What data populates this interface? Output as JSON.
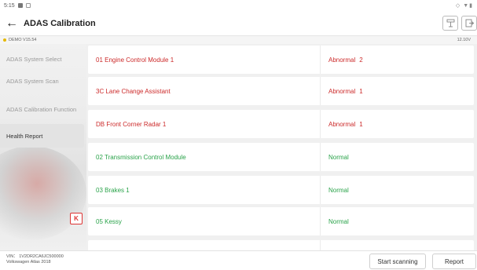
{
  "status_bar": {
    "time": "5:15",
    "right": "◇ ▼▮"
  },
  "header": {
    "title": "ADAS Calibration",
    "back_glyph": "←"
  },
  "info_bar": {
    "version": "DEMO V15.54",
    "voltage": "12.10V"
  },
  "sidebar": {
    "items": [
      {
        "label": "ADAS System Select",
        "active": false
      },
      {
        "label": "ADAS System Scan",
        "active": false
      },
      {
        "label": "ADAS Calibration Function",
        "active": false
      },
      {
        "label": "Health Report",
        "active": true
      }
    ],
    "collapse_label": "K"
  },
  "modules": [
    {
      "name": "01 Engine Control Module 1",
      "status": "Abnormal",
      "count": "2",
      "state": "abnormal"
    },
    {
      "name": "3C Lane Change Assistant",
      "status": "Abnormal",
      "count": "1",
      "state": "abnormal"
    },
    {
      "name": "DB Front Corner Radar 1",
      "status": "Abnormal",
      "count": "1",
      "state": "abnormal"
    },
    {
      "name": "02 Transmission Control Module",
      "status": "Normal",
      "count": "",
      "state": "normal"
    },
    {
      "name": "03 Brakes 1",
      "status": "Normal",
      "count": "",
      "state": "normal"
    },
    {
      "name": "05 Kessy",
      "status": "Normal",
      "count": "",
      "state": "normal"
    }
  ],
  "footer": {
    "vin": "VIN： 1V2DR2CA6JC500000",
    "vehicle": "Volkswagen Atlas 2018",
    "start_scanning_label": "Start scanning",
    "report_label": "Report"
  },
  "colors": {
    "abnormal": "#cc2a2a",
    "normal": "#2aa34a",
    "accent": "#d33333"
  }
}
